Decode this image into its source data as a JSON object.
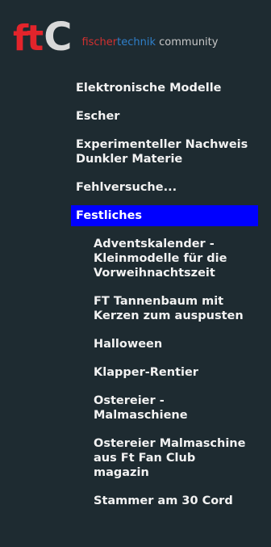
{
  "brand": {
    "logo_f": "f",
    "logo_t": "t",
    "logo_c": "C",
    "tagline_part1": "fischer",
    "tagline_part2": "technik",
    "tagline_part3": " community"
  },
  "nav": {
    "top_items": [
      "Elektronische Modelle",
      "Escher",
      "Experimenteller Nachweis Dunkler Materie",
      "Fehlversuche...",
      "Festliches"
    ],
    "active_index": 4,
    "sub_items": [
      "Adventskalender - Kleinmodelle für die Vorweihnachtszeit",
      "FT Tannenbaum mit Kerzen zum auspusten",
      "Halloween",
      "Klapper-Rentier",
      "Ostereier - Malmaschiene",
      "Ostereier Malmaschine aus Ft Fan Club magazin",
      "Stammer am 30 Cord"
    ]
  },
  "colors": {
    "background": "#1e2b31",
    "active_highlight": "#0000ff",
    "logo_red": "#e3242b",
    "tagline_blue": "#2f7fc9"
  }
}
